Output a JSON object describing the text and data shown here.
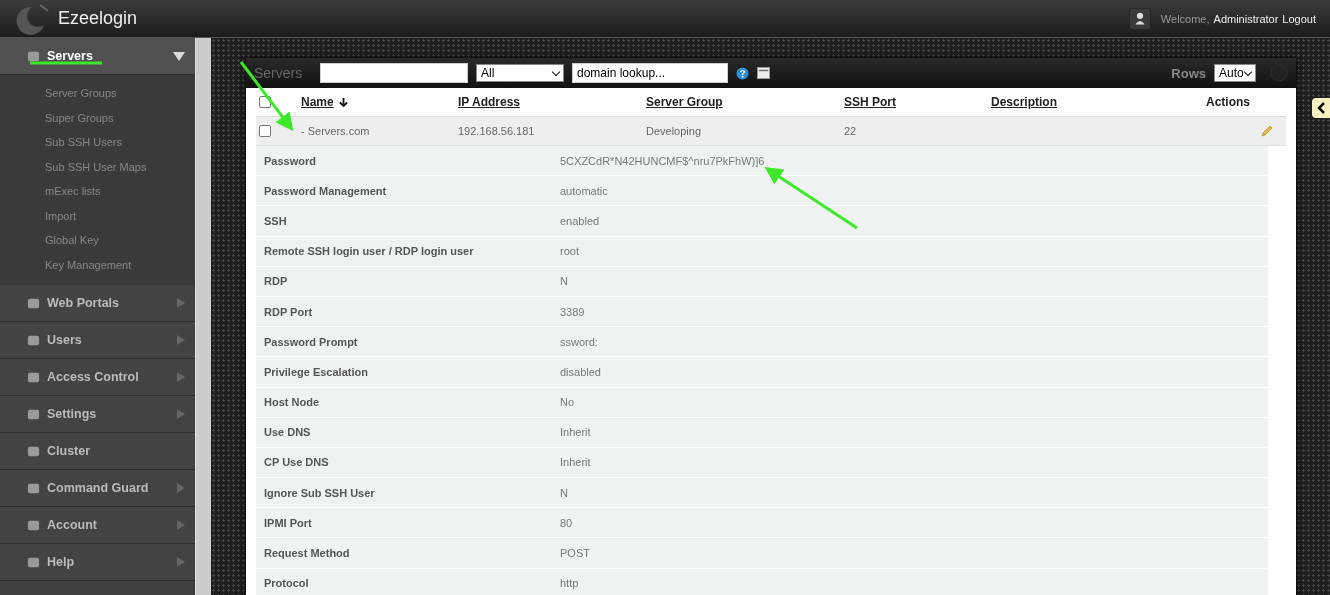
{
  "header": {
    "title": "Ezeelogin",
    "welcome": "Welcome,",
    "user": "Administrator",
    "logout": "Logout"
  },
  "sidebar": {
    "items": [
      {
        "label": "Servers",
        "kind": "menu",
        "expanded": true,
        "children": [
          {
            "label": "Server Groups"
          },
          {
            "label": "Super Groups"
          },
          {
            "label": "Sub SSH Users"
          },
          {
            "label": "Sub SSH User Maps"
          },
          {
            "label": "mExec lists"
          },
          {
            "label": "Import"
          },
          {
            "label": "Global Key"
          },
          {
            "label": "Key Management"
          }
        ]
      },
      {
        "label": "Web Portals",
        "kind": "menu",
        "expanded": false
      },
      {
        "label": "Users",
        "kind": "menu",
        "expanded": false
      },
      {
        "label": "Access Control",
        "kind": "menu",
        "expanded": false
      },
      {
        "label": "Settings",
        "kind": "menu",
        "expanded": false
      },
      {
        "label": "Cluster",
        "kind": "link",
        "expanded": false
      },
      {
        "label": "Command Guard",
        "kind": "menu",
        "expanded": false
      },
      {
        "label": "Account",
        "kind": "menu",
        "expanded": false
      },
      {
        "label": "Help",
        "kind": "menu",
        "expanded": false
      }
    ]
  },
  "toolbar": {
    "title": "Servers",
    "filter": "All",
    "lookup": "domain lookup...",
    "rows_label": "Rows",
    "rows": "Auto"
  },
  "table": {
    "all_checked": false,
    "columns": [
      {
        "label": "Name",
        "sortable": true,
        "sorted": true
      },
      {
        "label": "IP Address",
        "sortable": true,
        "sorted": false
      },
      {
        "label": "Server Group",
        "sortable": true,
        "sorted": false
      },
      {
        "label": "SSH Port",
        "sortable": true,
        "sorted": false
      },
      {
        "label": "Description",
        "sortable": true,
        "sorted": false
      },
      {
        "label": "Actions",
        "sortable": false,
        "sorted": false
      }
    ],
    "rows": [
      {
        "checked": false,
        "name": "- Servers.com",
        "ip": "192.168.56.181",
        "group": "Developing",
        "port": "22"
      }
    ],
    "details": [
      {
        "label": "Password",
        "value": "5CXZCdR*N42HUNCMF$^nru7PkFhW)]6"
      },
      {
        "label": "Password Management",
        "value": "automatic"
      },
      {
        "label": "SSH",
        "value": "enabled"
      },
      {
        "label": "Remote SSH login user / RDP login user",
        "value": "root"
      },
      {
        "label": "RDP",
        "value": "N"
      },
      {
        "label": "RDP Port",
        "value": "3389"
      },
      {
        "label": "Password Prompt",
        "value": "ssword:"
      },
      {
        "label": "Privilege Escalation",
        "value": "disabled"
      },
      {
        "label": "Host Node",
        "value": "No"
      },
      {
        "label": "Use DNS",
        "value": "Inherit"
      },
      {
        "label": "CP Use DNS",
        "value": "Inherit"
      },
      {
        "label": "Ignore Sub SSH User",
        "value": "N"
      },
      {
        "label": "IPMI Port",
        "value": "80"
      },
      {
        "label": "Request Method",
        "value": "POST"
      },
      {
        "label": "Protocol",
        "value": "http"
      }
    ]
  }
}
